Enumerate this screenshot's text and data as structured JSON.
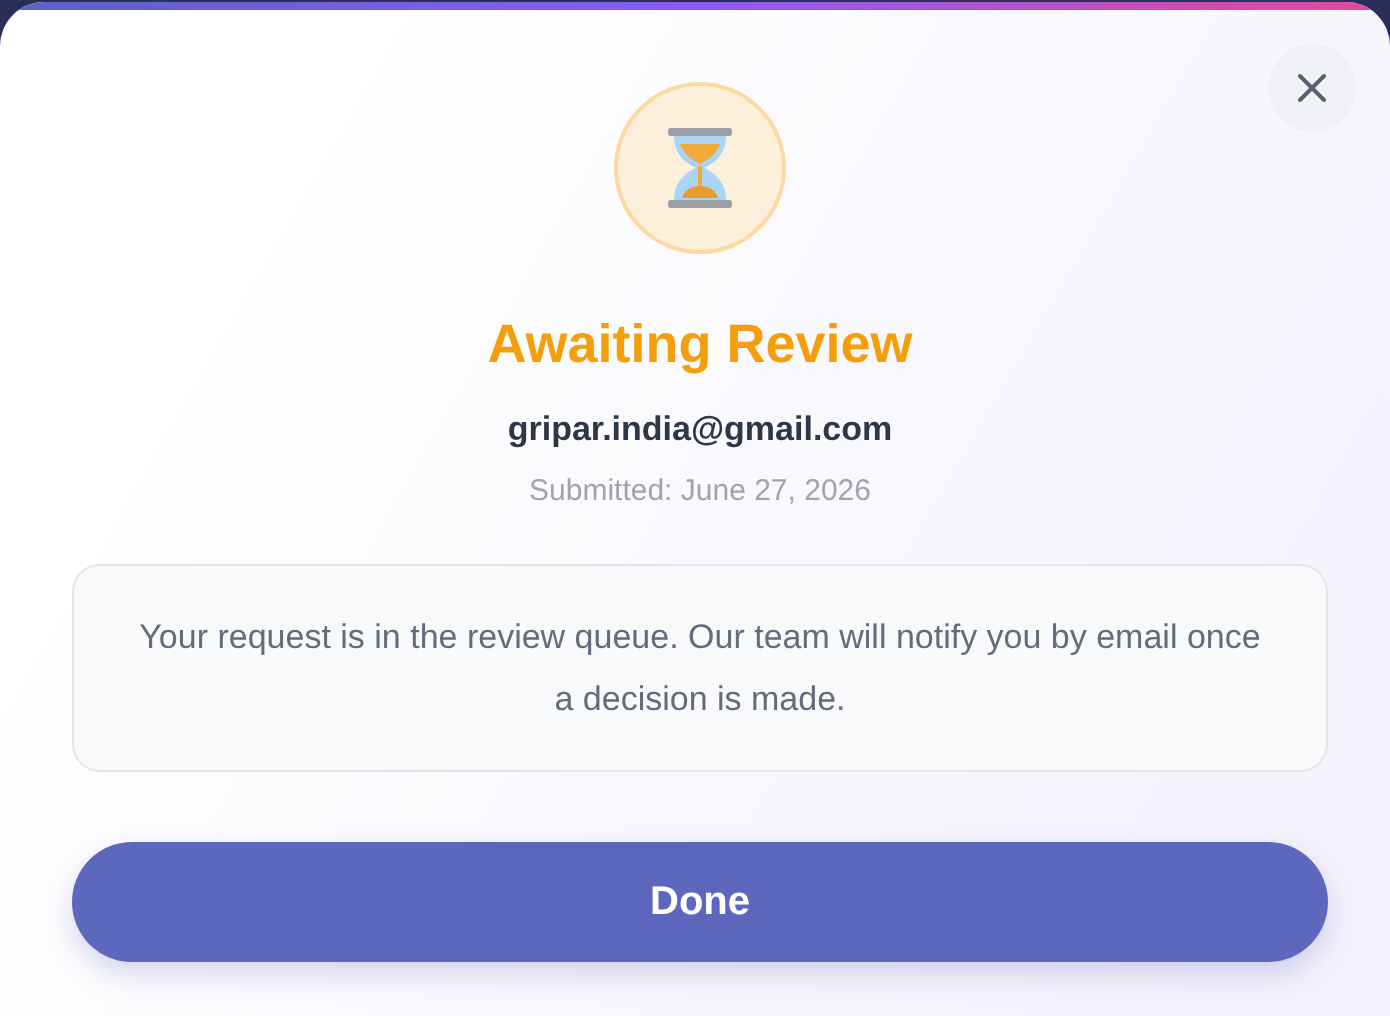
{
  "dialog": {
    "kind": "pending",
    "title": "Awaiting Review",
    "email": "gripar.india@gmail.com",
    "submitted": "Submitted: June 27, 2026",
    "message": "Your request is in the review queue. Our team will notify you by email once a decision is made.",
    "button": "Done"
  }
}
